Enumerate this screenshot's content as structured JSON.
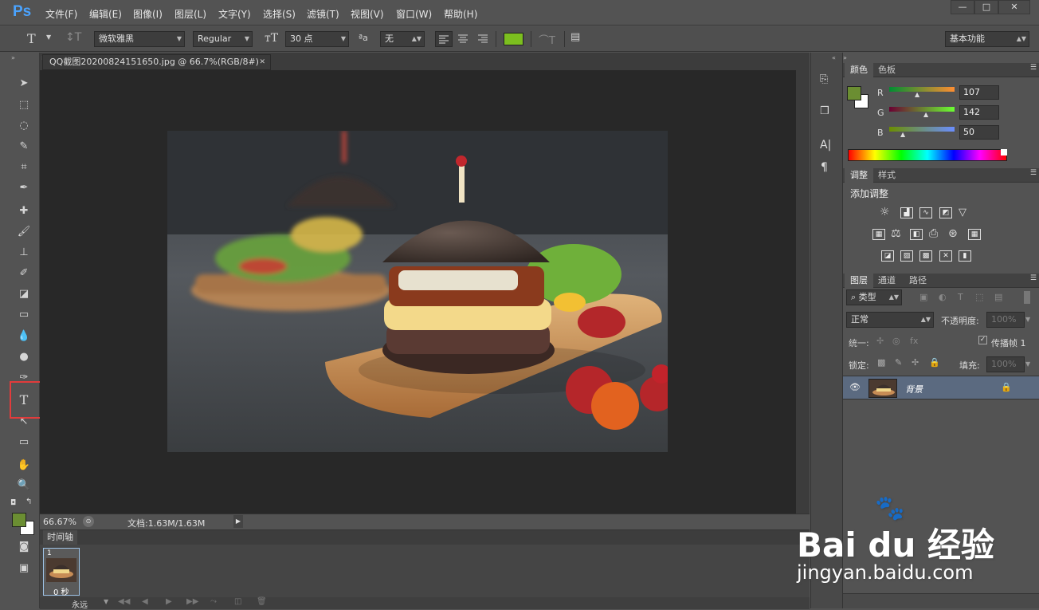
{
  "app": {
    "logo": "Ps"
  },
  "menu": [
    "文件(F)",
    "编辑(E)",
    "图像(I)",
    "图层(L)",
    "文字(Y)",
    "选择(S)",
    "滤镜(T)",
    "视图(V)",
    "窗口(W)",
    "帮助(H)"
  ],
  "window_buttons": [
    "—",
    "□",
    "✕"
  ],
  "options": {
    "font_family": "微软雅黑",
    "font_style": "Regular",
    "font_size": "30 点",
    "aa_label": "ªa",
    "antialias": "无",
    "text_color": "#7cbf1f",
    "workspace": "基本功能"
  },
  "document": {
    "tab_title": "QQ截图20200824151650.jpg @ 66.7%(RGB/8#)",
    "tab_close": "✕"
  },
  "status": {
    "zoom": "66.67%",
    "doc_info": "文档:1.63M/1.63M"
  },
  "timeline": {
    "tab": "时间轴",
    "frame_number": "1",
    "frame_delay": "0 秒",
    "loop": "永远"
  },
  "color_panel": {
    "tabs": [
      "颜色",
      "色板"
    ],
    "r_label": "R",
    "g_label": "G",
    "b_label": "B",
    "r": "107",
    "g": "142",
    "b": "50",
    "foreground": "#6b8e32",
    "background": "#ffffff"
  },
  "adjust_panel": {
    "tabs": [
      "调整",
      "样式"
    ],
    "title": "添加调整"
  },
  "layers_panel": {
    "tabs": [
      "图层",
      "通道",
      "路径"
    ],
    "kind_filter": "类型",
    "blend_mode": "正常",
    "opacity_label": "不透明度:",
    "opacity_value": "100%",
    "unify_label": "统一:",
    "propagate_label": "传播帧 1",
    "lock_label": "锁定:",
    "fill_label": "填充:",
    "fill_value": "100%",
    "layer_name": "背景"
  },
  "toolbar": {
    "foreground": "#6b8e32",
    "background": "#ffffff"
  },
  "watermark": {
    "logo": "Bai du 经验",
    "url": "jingyan.baidu.com"
  }
}
